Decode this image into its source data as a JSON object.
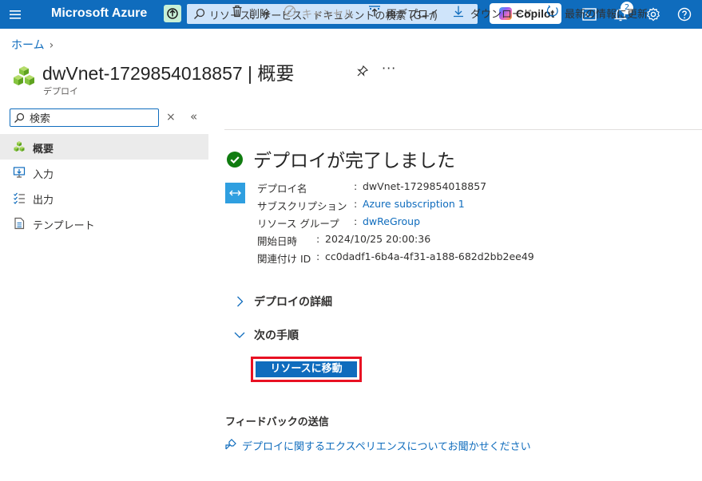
{
  "topbar": {
    "brand": "Microsoft Azure",
    "search_placeholder": "リソース、サービス、ドキュメントの検索 (G+/)",
    "copilot_label": "Copilot",
    "notification_count": "2",
    "icons": [
      "menu-icon",
      "upgrade-icon",
      "search-icon",
      "cloud-shell-icon",
      "notifications-icon",
      "settings-icon",
      "help-icon"
    ],
    "colors": {
      "bar": "#0f6cbd",
      "search_bg": "#cfe4fa"
    }
  },
  "breadcrumb": {
    "home": "ホーム",
    "separator": "›"
  },
  "header": {
    "title": "dwVnet-1729854018857 | 概要",
    "subtitle": "デプロイ",
    "more": "···"
  },
  "sidebar": {
    "search_value": "検索",
    "items": [
      {
        "label": "概要",
        "icon": "overview-icon",
        "active": true
      },
      {
        "label": "入力",
        "icon": "input-icon",
        "active": false
      },
      {
        "label": "出力",
        "icon": "output-icon",
        "active": false
      },
      {
        "label": "テンプレート",
        "icon": "template-icon",
        "active": false
      }
    ]
  },
  "commands": [
    {
      "label": "削除",
      "icon": "delete-icon",
      "enabled": true
    },
    {
      "label": "キャンセル",
      "icon": "cancel-icon",
      "enabled": false
    },
    {
      "label": "再デプロイ",
      "icon": "redeploy-icon",
      "enabled": true
    },
    {
      "label": "ダウンロード",
      "icon": "download-icon",
      "enabled": true
    },
    {
      "label": "最新の情報に更新",
      "icon": "refresh-icon",
      "enabled": true
    }
  ],
  "status": {
    "title": "デプロイが完了しました",
    "color": "#107c10"
  },
  "details": [
    {
      "key": "デプロイ名",
      "sep": ":",
      "value": "dwVnet-1729854018857",
      "link": false
    },
    {
      "key": "サブスクリプション",
      "sep": ":",
      "value": "Azure subscription 1",
      "link": true
    },
    {
      "key": "リソース グループ",
      "sep": ":",
      "value": "dwReGroup",
      "link": true
    },
    {
      "key": "開始日時",
      "sep": ":",
      "value": "2024/10/25 20:00:36",
      "link": false
    },
    {
      "key": "関連付け ID",
      "sep": ":",
      "value": "cc0dadf1-6b4a-4f31-a188-682d2bb2ee49",
      "link": false
    }
  ],
  "sections": {
    "details": "デプロイの詳細",
    "next_steps": "次の手順",
    "go_to_resource": "リソースに移動"
  },
  "feedback": {
    "title": "フィードバックの送信",
    "link": "デプロイに関するエクスペリエンスについてお聞かせください"
  }
}
